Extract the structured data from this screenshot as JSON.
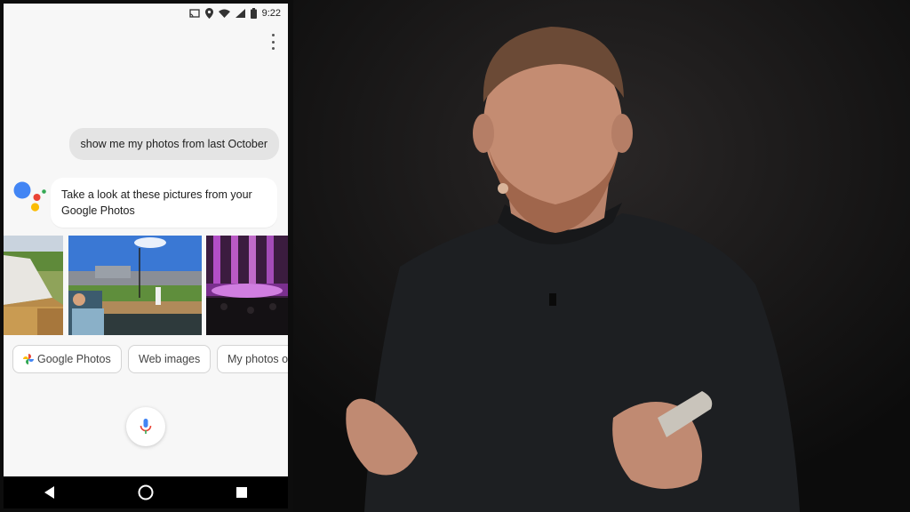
{
  "status_bar": {
    "time": "9:22",
    "icons": [
      "cast-icon",
      "location-icon",
      "wifi-icon",
      "cell-signal-icon",
      "battery-icon"
    ]
  },
  "conversation": {
    "user_query": "show me my photos from last October",
    "assistant_response": "Take a look at these pictures from your Google Photos"
  },
  "photos": [
    {
      "description_icon": "photo-tent-field"
    },
    {
      "description_icon": "photo-baseball-stadium"
    },
    {
      "description_icon": "photo-concert-stage"
    }
  ],
  "suggestion_chips": {
    "google_photos": "Google Photos",
    "web_images": "Web images",
    "my_photos": "My photos of"
  },
  "colors": {
    "assistant_blue": "#4285F4",
    "assistant_red": "#EA4335",
    "assistant_yellow": "#FBBC05",
    "assistant_green": "#34A853",
    "chip_bubble": "#e4e4e4"
  },
  "nav_bar": {
    "icons": [
      "back-icon",
      "home-icon",
      "recents-icon"
    ]
  }
}
